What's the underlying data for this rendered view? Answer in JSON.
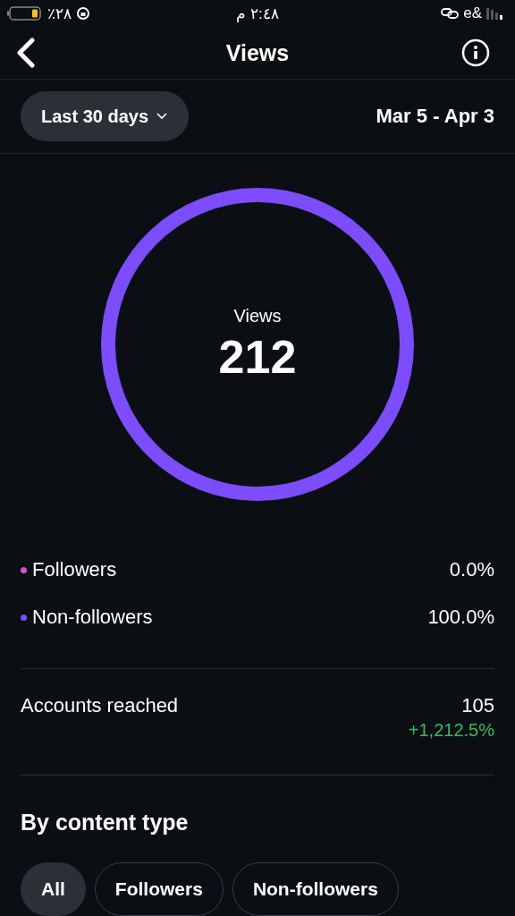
{
  "status_bar": {
    "battery": "٪٢٨",
    "time": "٢:٤٨ م",
    "carrier": "e&"
  },
  "header": {
    "title": "Views"
  },
  "filter": {
    "range": "Last 30 days",
    "dates": "Mar 5 - Apr 3"
  },
  "summary": {
    "label": "Views",
    "value": "212"
  },
  "legend": [
    {
      "label": "Followers",
      "value": "0.0%",
      "color": "#d94fd0"
    },
    {
      "label": "Non-followers",
      "value": "100.0%",
      "color": "#7b4dff"
    }
  ],
  "accounts_reached": {
    "label": "Accounts reached",
    "value": "105",
    "change": "+1,212.5%"
  },
  "content_type": {
    "heading": "By content type",
    "chips": [
      {
        "label": "All",
        "selected": true
      },
      {
        "label": "Followers",
        "selected": false
      },
      {
        "label": "Non-followers",
        "selected": false
      }
    ]
  }
}
